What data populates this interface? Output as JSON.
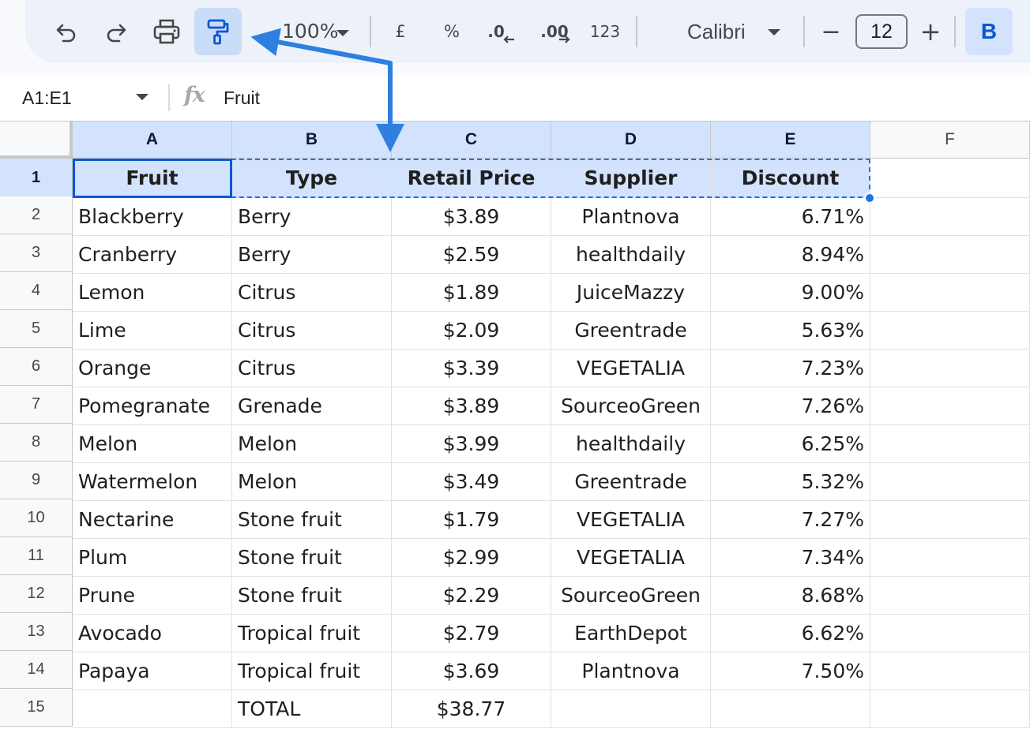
{
  "toolbar": {
    "undo_icon": "undo-icon",
    "redo_icon": "redo-icon",
    "print_icon": "print-icon",
    "paint_format_icon": "paint-format-icon",
    "zoom": "100%",
    "currency": "£",
    "percent": "%",
    "decrease_decimal": ".0",
    "increase_decimal": ".00",
    "number_format": "123",
    "font": "Calibri",
    "minus": "−",
    "font_size": "12",
    "plus": "+",
    "bold": "B"
  },
  "formula_bar": {
    "name_box": "A1:E1",
    "fx": "fx",
    "value": "Fruit"
  },
  "sheet": {
    "columns": [
      "A",
      "B",
      "C",
      "D",
      "E",
      "F"
    ],
    "row_numbers": [
      "1",
      "2",
      "3",
      "4",
      "5",
      "6",
      "7",
      "8",
      "9",
      "10",
      "11",
      "12",
      "13",
      "14",
      "15"
    ],
    "header": [
      "Fruit",
      "Type",
      "Retail Price",
      "Supplier",
      "Discount"
    ],
    "rows": [
      [
        "Blackberry",
        "Berry",
        "$3.89",
        "Plantnova",
        "6.71%"
      ],
      [
        "Cranberry",
        "Berry",
        "$2.59",
        "healthdaily",
        "8.94%"
      ],
      [
        "Lemon",
        "Citrus",
        "$1.89",
        "JuiceMazzy",
        "9.00%"
      ],
      [
        "Lime",
        "Citrus",
        "$2.09",
        "Greentrade",
        "5.63%"
      ],
      [
        "Orange",
        "Citrus",
        "$3.39",
        "VEGETALIA",
        "7.23%"
      ],
      [
        "Pomegranate",
        "Grenade",
        "$3.89",
        "SourceoGreen",
        "7.26%"
      ],
      [
        "Melon",
        "Melon",
        "$3.99",
        "healthdaily",
        "6.25%"
      ],
      [
        "Watermelon",
        "Melon",
        "$3.49",
        "Greentrade",
        "5.32%"
      ],
      [
        "Nectarine",
        "Stone fruit",
        "$1.79",
        "VEGETALIA",
        "7.27%"
      ],
      [
        "Plum",
        "Stone fruit",
        "$2.99",
        "VEGETALIA",
        "7.34%"
      ],
      [
        "Prune",
        "Stone fruit",
        "$2.29",
        "SourceoGreen",
        "8.68%"
      ],
      [
        "Avocado",
        "Tropical fruit",
        "$2.79",
        "EarthDepot",
        "6.62%"
      ],
      [
        "Papaya",
        "Tropical fruit",
        "$3.69",
        "Plantnova",
        "7.50%"
      ],
      [
        "",
        "TOTAL",
        "$38.77",
        "",
        ""
      ]
    ]
  },
  "colors": {
    "accent": "#0b57d0",
    "selection_fill": "#d3e3fd",
    "annotation_arrow": "#2f7fe0"
  }
}
